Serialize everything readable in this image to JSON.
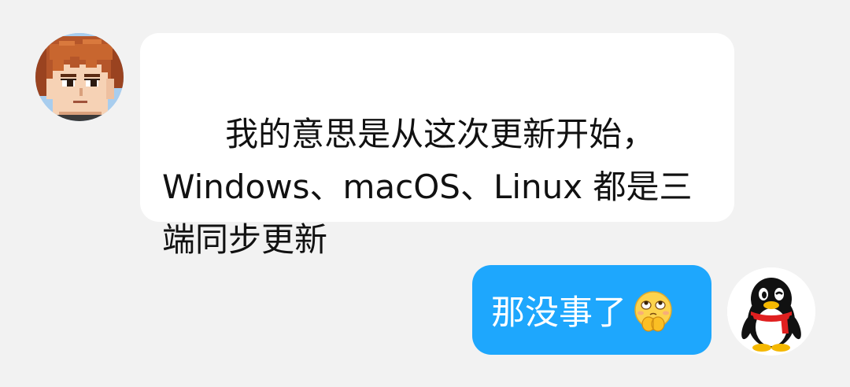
{
  "incoming": {
    "avatar_icon": "pixel-art-anime-boy-avatar",
    "text": "我的意思是从这次更新开始，\nWindows、macOS、Linux 都是三\n端同步更新"
  },
  "outgoing": {
    "avatar_icon": "qq-penguin-avatar",
    "text": "那没事了",
    "emoji_icon": "thinking-praying-emoji"
  },
  "colors": {
    "background": "#f2f2f2",
    "incoming_bubble": "#ffffff",
    "outgoing_bubble": "#1ea7fd",
    "incoming_text": "#111111",
    "outgoing_text": "#ffffff"
  }
}
